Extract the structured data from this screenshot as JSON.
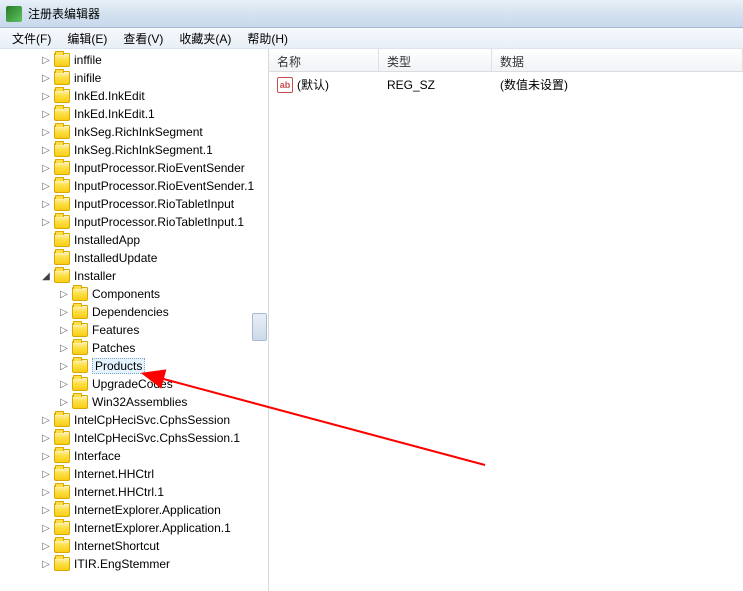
{
  "window": {
    "title": "注册表编辑器"
  },
  "menu": {
    "file": "文件(F)",
    "edit": "编辑(E)",
    "view": "查看(V)",
    "favorites": "收藏夹(A)",
    "help": "帮助(H)"
  },
  "tree": {
    "items": [
      {
        "label": "inffile",
        "indent": 1,
        "exp": "collapsed"
      },
      {
        "label": "inifile",
        "indent": 1,
        "exp": "collapsed"
      },
      {
        "label": "InkEd.InkEdit",
        "indent": 1,
        "exp": "collapsed"
      },
      {
        "label": "InkEd.InkEdit.1",
        "indent": 1,
        "exp": "collapsed"
      },
      {
        "label": "InkSeg.RichInkSegment",
        "indent": 1,
        "exp": "collapsed"
      },
      {
        "label": "InkSeg.RichInkSegment.1",
        "indent": 1,
        "exp": "collapsed"
      },
      {
        "label": "InputProcessor.RioEventSender",
        "indent": 1,
        "exp": "collapsed"
      },
      {
        "label": "InputProcessor.RioEventSender.1",
        "indent": 1,
        "exp": "collapsed"
      },
      {
        "label": "InputProcessor.RioTabletInput",
        "indent": 1,
        "exp": "collapsed"
      },
      {
        "label": "InputProcessor.RioTabletInput.1",
        "indent": 1,
        "exp": "collapsed"
      },
      {
        "label": "InstalledApp",
        "indent": 1,
        "exp": "none"
      },
      {
        "label": "InstalledUpdate",
        "indent": 1,
        "exp": "none"
      },
      {
        "label": "Installer",
        "indent": 1,
        "exp": "expanded"
      },
      {
        "label": "Components",
        "indent": 2,
        "exp": "collapsed"
      },
      {
        "label": "Dependencies",
        "indent": 2,
        "exp": "collapsed"
      },
      {
        "label": "Features",
        "indent": 2,
        "exp": "collapsed"
      },
      {
        "label": "Patches",
        "indent": 2,
        "exp": "collapsed"
      },
      {
        "label": "Products",
        "indent": 2,
        "exp": "collapsed",
        "selected": true
      },
      {
        "label": "UpgradeCodes",
        "indent": 2,
        "exp": "collapsed"
      },
      {
        "label": "Win32Assemblies",
        "indent": 2,
        "exp": "collapsed"
      },
      {
        "label": "IntelCpHeciSvc.CphsSession",
        "indent": 1,
        "exp": "collapsed"
      },
      {
        "label": "IntelCpHeciSvc.CphsSession.1",
        "indent": 1,
        "exp": "collapsed"
      },
      {
        "label": "Interface",
        "indent": 1,
        "exp": "collapsed"
      },
      {
        "label": "Internet.HHCtrl",
        "indent": 1,
        "exp": "collapsed"
      },
      {
        "label": "Internet.HHCtrl.1",
        "indent": 1,
        "exp": "collapsed"
      },
      {
        "label": "InternetExplorer.Application",
        "indent": 1,
        "exp": "collapsed"
      },
      {
        "label": "InternetExplorer.Application.1",
        "indent": 1,
        "exp": "collapsed"
      },
      {
        "label": "InternetShortcut",
        "indent": 1,
        "exp": "collapsed"
      },
      {
        "label": "ITIR.EngStemmer",
        "indent": 1,
        "exp": "collapsed"
      }
    ]
  },
  "list": {
    "columns": {
      "name": "名称",
      "type": "类型",
      "data": "数据"
    },
    "rows": [
      {
        "icon": "ab",
        "name": "(默认)",
        "type": "REG_SZ",
        "data": "(数值未设置)"
      }
    ]
  }
}
